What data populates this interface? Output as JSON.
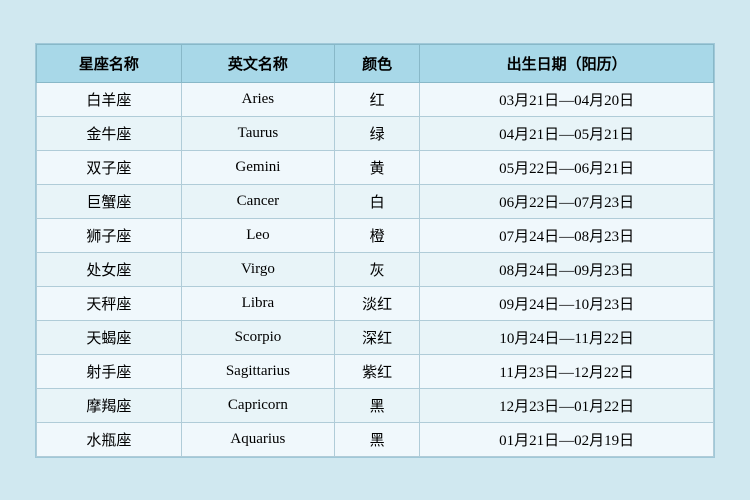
{
  "table": {
    "headers": [
      "星座名称",
      "英文名称",
      "颜色",
      "出生日期（阳历）"
    ],
    "rows": [
      {
        "chinese": "白羊座",
        "english": "Aries",
        "color": "红",
        "dates": "03月21日—04月20日"
      },
      {
        "chinese": "金牛座",
        "english": "Taurus",
        "color": "绿",
        "dates": "04月21日—05月21日"
      },
      {
        "chinese": "双子座",
        "english": "Gemini",
        "color": "黄",
        "dates": "05月22日—06月21日"
      },
      {
        "chinese": "巨蟹座",
        "english": "Cancer",
        "color": "白",
        "dates": "06月22日—07月23日"
      },
      {
        "chinese": "狮子座",
        "english": "Leo",
        "color": "橙",
        "dates": "07月24日—08月23日"
      },
      {
        "chinese": "处女座",
        "english": "Virgo",
        "color": "灰",
        "dates": "08月24日—09月23日"
      },
      {
        "chinese": "天秤座",
        "english": "Libra",
        "color": "淡红",
        "dates": "09月24日—10月23日"
      },
      {
        "chinese": "天蝎座",
        "english": "Scorpio",
        "color": "深红",
        "dates": "10月24日—11月22日"
      },
      {
        "chinese": "射手座",
        "english": "Sagittarius",
        "color": "紫红",
        "dates": "11月23日—12月22日"
      },
      {
        "chinese": "摩羯座",
        "english": "Capricorn",
        "color": "黑",
        "dates": "12月23日—01月22日"
      },
      {
        "chinese": "水瓶座",
        "english": "Aquarius",
        "color": "黑",
        "dates": "01月21日—02月19日"
      }
    ]
  }
}
